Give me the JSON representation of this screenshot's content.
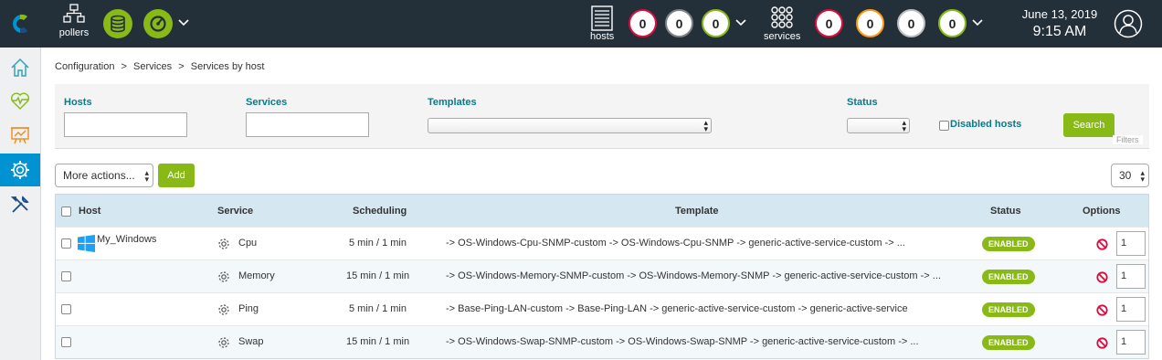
{
  "topbar": {
    "pollers_label": "pollers",
    "hosts_label": "hosts",
    "services_label": "services",
    "host_counters": [
      {
        "value": "0",
        "color": "#e00b3d"
      },
      {
        "value": "0",
        "color": "#818285"
      },
      {
        "value": "0",
        "color": "#88b917"
      }
    ],
    "service_counters": [
      {
        "value": "0",
        "color": "#e00b3d"
      },
      {
        "value": "0",
        "color": "#ff9a13"
      },
      {
        "value": "0",
        "color": "#bcbdc0"
      },
      {
        "value": "0",
        "color": "#88b917"
      }
    ],
    "date": "June 13, 2019",
    "time": "9:15 AM"
  },
  "breadcrumb": [
    "Configuration",
    ">",
    "Services",
    ">",
    "Services by host"
  ],
  "filters": {
    "hosts_label": "Hosts",
    "services_label": "Services",
    "templates_label": "Templates",
    "status_label": "Status",
    "disabled_hosts_label": "Disabled hosts",
    "search_label": "Search",
    "filters_caption": "Filters",
    "hosts_value": "",
    "services_value": ""
  },
  "actions": {
    "more_actions_label": "More actions...",
    "add_label": "Add",
    "page_size": "30"
  },
  "table": {
    "headers": {
      "host": "Host",
      "service": "Service",
      "scheduling": "Scheduling",
      "template": "Template",
      "status": "Status",
      "options": "Options"
    },
    "rows": [
      {
        "host": "My_Windows",
        "service": "Cpu",
        "scheduling": "5 min / 1 min",
        "template": "-> OS-Windows-Cpu-SNMP-custom -> OS-Windows-Cpu-SNMP -> generic-active-service-custom -> ...",
        "status": "ENABLED",
        "option_value": "1"
      },
      {
        "host": "",
        "service": "Memory",
        "scheduling": "15 min / 1 min",
        "template": "-> OS-Windows-Memory-SNMP-custom -> OS-Windows-Memory-SNMP -> generic-active-service-custom -> ...",
        "status": "ENABLED",
        "option_value": "1"
      },
      {
        "host": "",
        "service": "Ping",
        "scheduling": "5 min / 1 min",
        "template": "-> Base-Ping-LAN-custom -> Base-Ping-LAN -> generic-active-service-custom -> generic-active-service",
        "status": "ENABLED",
        "option_value": "1"
      },
      {
        "host": "",
        "service": "Swap",
        "scheduling": "15 min / 1 min",
        "template": "-> OS-Windows-Swap-SNMP-custom -> OS-Windows-Swap-SNMP -> generic-active-service-custom -> ...",
        "status": "ENABLED",
        "option_value": "1"
      }
    ]
  },
  "icons": {
    "logo": "centreon-logo-icon",
    "pollers": "pollers-icon",
    "database": "database-icon",
    "status": "poller-status-icon",
    "hosts": "hosts-icon",
    "services": "services-icon",
    "user": "user-icon",
    "sidebar": [
      "home-icon",
      "monitoring-icon",
      "reporting-icon",
      "configuration-icon",
      "administration-icon"
    ]
  }
}
